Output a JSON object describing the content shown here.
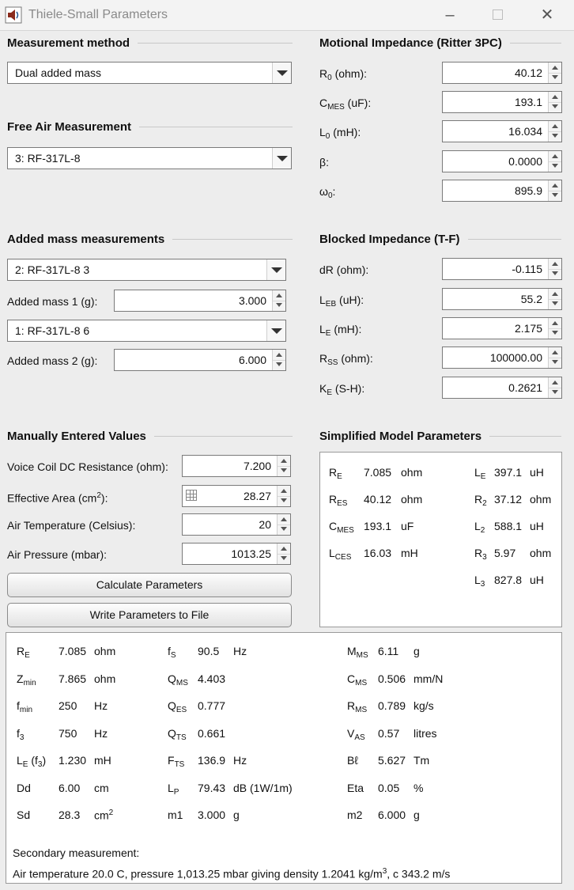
{
  "window": {
    "title": "Thiele-Small Parameters"
  },
  "measurement_method": {
    "heading": "Measurement method",
    "selected": "Dual added mass"
  },
  "free_air": {
    "heading": "Free Air Measurement",
    "selected": "3: RF-317L-8"
  },
  "added_mass": {
    "heading": "Added mass measurements",
    "selected1": "2: RF-317L-8 3",
    "mass1_label": "Added mass 1 (g):",
    "mass1_value": "3.000",
    "selected2": "1: RF-317L-8 6",
    "mass2_label": "Added mass 2 (g):",
    "mass2_value": "6.000"
  },
  "motional": {
    "heading": "Motional Impedance (Ritter 3PC)",
    "fields": [
      {
        "sym": "R",
        "sub": "0",
        "unit": " (ohm):",
        "value": "40.12"
      },
      {
        "sym": "C",
        "sub": "MES",
        "unit": " (uF):",
        "value": "193.1"
      },
      {
        "sym": "L",
        "sub": "0",
        "unit": " (mH):",
        "value": "16.034"
      },
      {
        "sym": "β",
        "sub": "",
        "unit": ":",
        "value": "0.0000"
      },
      {
        "sym": "ω",
        "sub": "0",
        "unit": ":",
        "value": "895.9"
      }
    ]
  },
  "blocked": {
    "heading": "Blocked Impedance (T-F)",
    "fields": [
      {
        "sym": "dR",
        "sub": "",
        "unit": " (ohm):",
        "value": "-0.115"
      },
      {
        "sym": "L",
        "sub": "EB",
        "unit": " (uH):",
        "value": "55.2"
      },
      {
        "sym": "L",
        "sub": "E",
        "unit": " (mH):",
        "value": "2.175"
      },
      {
        "sym": "R",
        "sub": "SS",
        "unit": " (ohm):",
        "value": "100000.00"
      },
      {
        "sym": "K",
        "sub": "E",
        "unit": " (S-H):",
        "value": "0.2621"
      }
    ]
  },
  "manual": {
    "heading": "Manually Entered Values",
    "dc_label": "Voice Coil DC Resistance (ohm):",
    "dc_value": "7.200",
    "area_label": "Effective Area (cm",
    "area_sup": "2",
    "area_tail": "):",
    "area_value": "28.27",
    "temp_label": "Air Temperature (Celsius):",
    "temp_value": "20",
    "pressure_label": "Air Pressure (mbar):",
    "pressure_value": "1013.25",
    "calc_button": "Calculate Parameters",
    "write_button": "Write Parameters to File"
  },
  "simplified": {
    "heading": "Simplified Model Parameters",
    "left": [
      {
        "sym": "R",
        "sub": "E",
        "value": "7.085",
        "unit": "ohm"
      },
      {
        "sym": "R",
        "sub": "ES",
        "value": "40.12",
        "unit": "ohm"
      },
      {
        "sym": "C",
        "sub": "MES",
        "value": "193.1",
        "unit": "uF"
      },
      {
        "sym": "L",
        "sub": "CES",
        "value": "16.03",
        "unit": "mH"
      }
    ],
    "right": [
      {
        "sym": "L",
        "sub": "E",
        "value": "397.1",
        "unit": "uH"
      },
      {
        "sym": "R",
        "sub": "2",
        "value": "37.12",
        "unit": "ohm"
      },
      {
        "sym": "L",
        "sub": "2",
        "value": "588.1",
        "unit": "uH"
      },
      {
        "sym": "R",
        "sub": "3",
        "value": "5.97",
        "unit": "ohm"
      },
      {
        "sym": "L",
        "sub": "3",
        "value": "827.8",
        "unit": "uH"
      }
    ]
  },
  "results": {
    "col1": [
      {
        "sym": "R",
        "sub": "E",
        "value": "7.085",
        "unit": "ohm"
      },
      {
        "sym": "Z",
        "sub": "min",
        "value": "7.865",
        "unit": "ohm"
      },
      {
        "sym": "f",
        "sub": "min",
        "value": "250",
        "unit": "Hz"
      },
      {
        "sym": "f",
        "sub": "3",
        "value": "750",
        "unit": "Hz"
      },
      {
        "sym": "L",
        "sub": "E",
        "extra": " (f",
        "extra_sub": "3",
        "extra_tail": ")",
        "value": "1.230",
        "unit": "mH"
      },
      {
        "sym": "Dd",
        "sub": "",
        "value": "6.00",
        "unit": "cm"
      },
      {
        "sym": "Sd",
        "sub": "",
        "value": "28.3",
        "unit": "cm",
        "unit_sup": "2"
      }
    ],
    "col2": [
      {
        "sym": "f",
        "sub": "S",
        "value": "90.5",
        "unit": "Hz"
      },
      {
        "sym": "Q",
        "sub": "MS",
        "value": "4.403",
        "unit": ""
      },
      {
        "sym": "Q",
        "sub": "ES",
        "value": "0.777",
        "unit": ""
      },
      {
        "sym": "Q",
        "sub": "TS",
        "value": "0.661",
        "unit": ""
      },
      {
        "sym": "F",
        "sub": "TS",
        "value": "136.9",
        "unit": "Hz"
      },
      {
        "sym": "L",
        "sub": "P",
        "value": "79.43",
        "unit": "dB (1W/1m)"
      },
      {
        "sym": "m1",
        "sub": "",
        "value": "3.000",
        "unit": "g"
      }
    ],
    "col3": [
      {
        "sym": "M",
        "sub": "MS",
        "value": "6.11",
        "unit": "g"
      },
      {
        "sym": "C",
        "sub": "MS",
        "value": "0.506",
        "unit": "mm/N"
      },
      {
        "sym": "R",
        "sub": "MS",
        "value": "0.789",
        "unit": "kg/s"
      },
      {
        "sym": "V",
        "sub": "AS",
        "value": "0.57",
        "unit": "litres"
      },
      {
        "sym": "Bℓ",
        "sub": "",
        "value": "5.627",
        "unit": "Tm"
      },
      {
        "sym": "Eta",
        "sub": "",
        "value": "0.05",
        "unit": "%"
      },
      {
        "sym": "m2",
        "sub": "",
        "value": "6.000",
        "unit": "g"
      }
    ],
    "secondary_label": "Secondary measurement:",
    "air_line_a": "Air temperature 20.0 C, pressure 1,013.25 mbar giving density 1.2041 kg/m",
    "air_line_sup": "3",
    "air_line_b": ", c 343.2 m/s"
  }
}
